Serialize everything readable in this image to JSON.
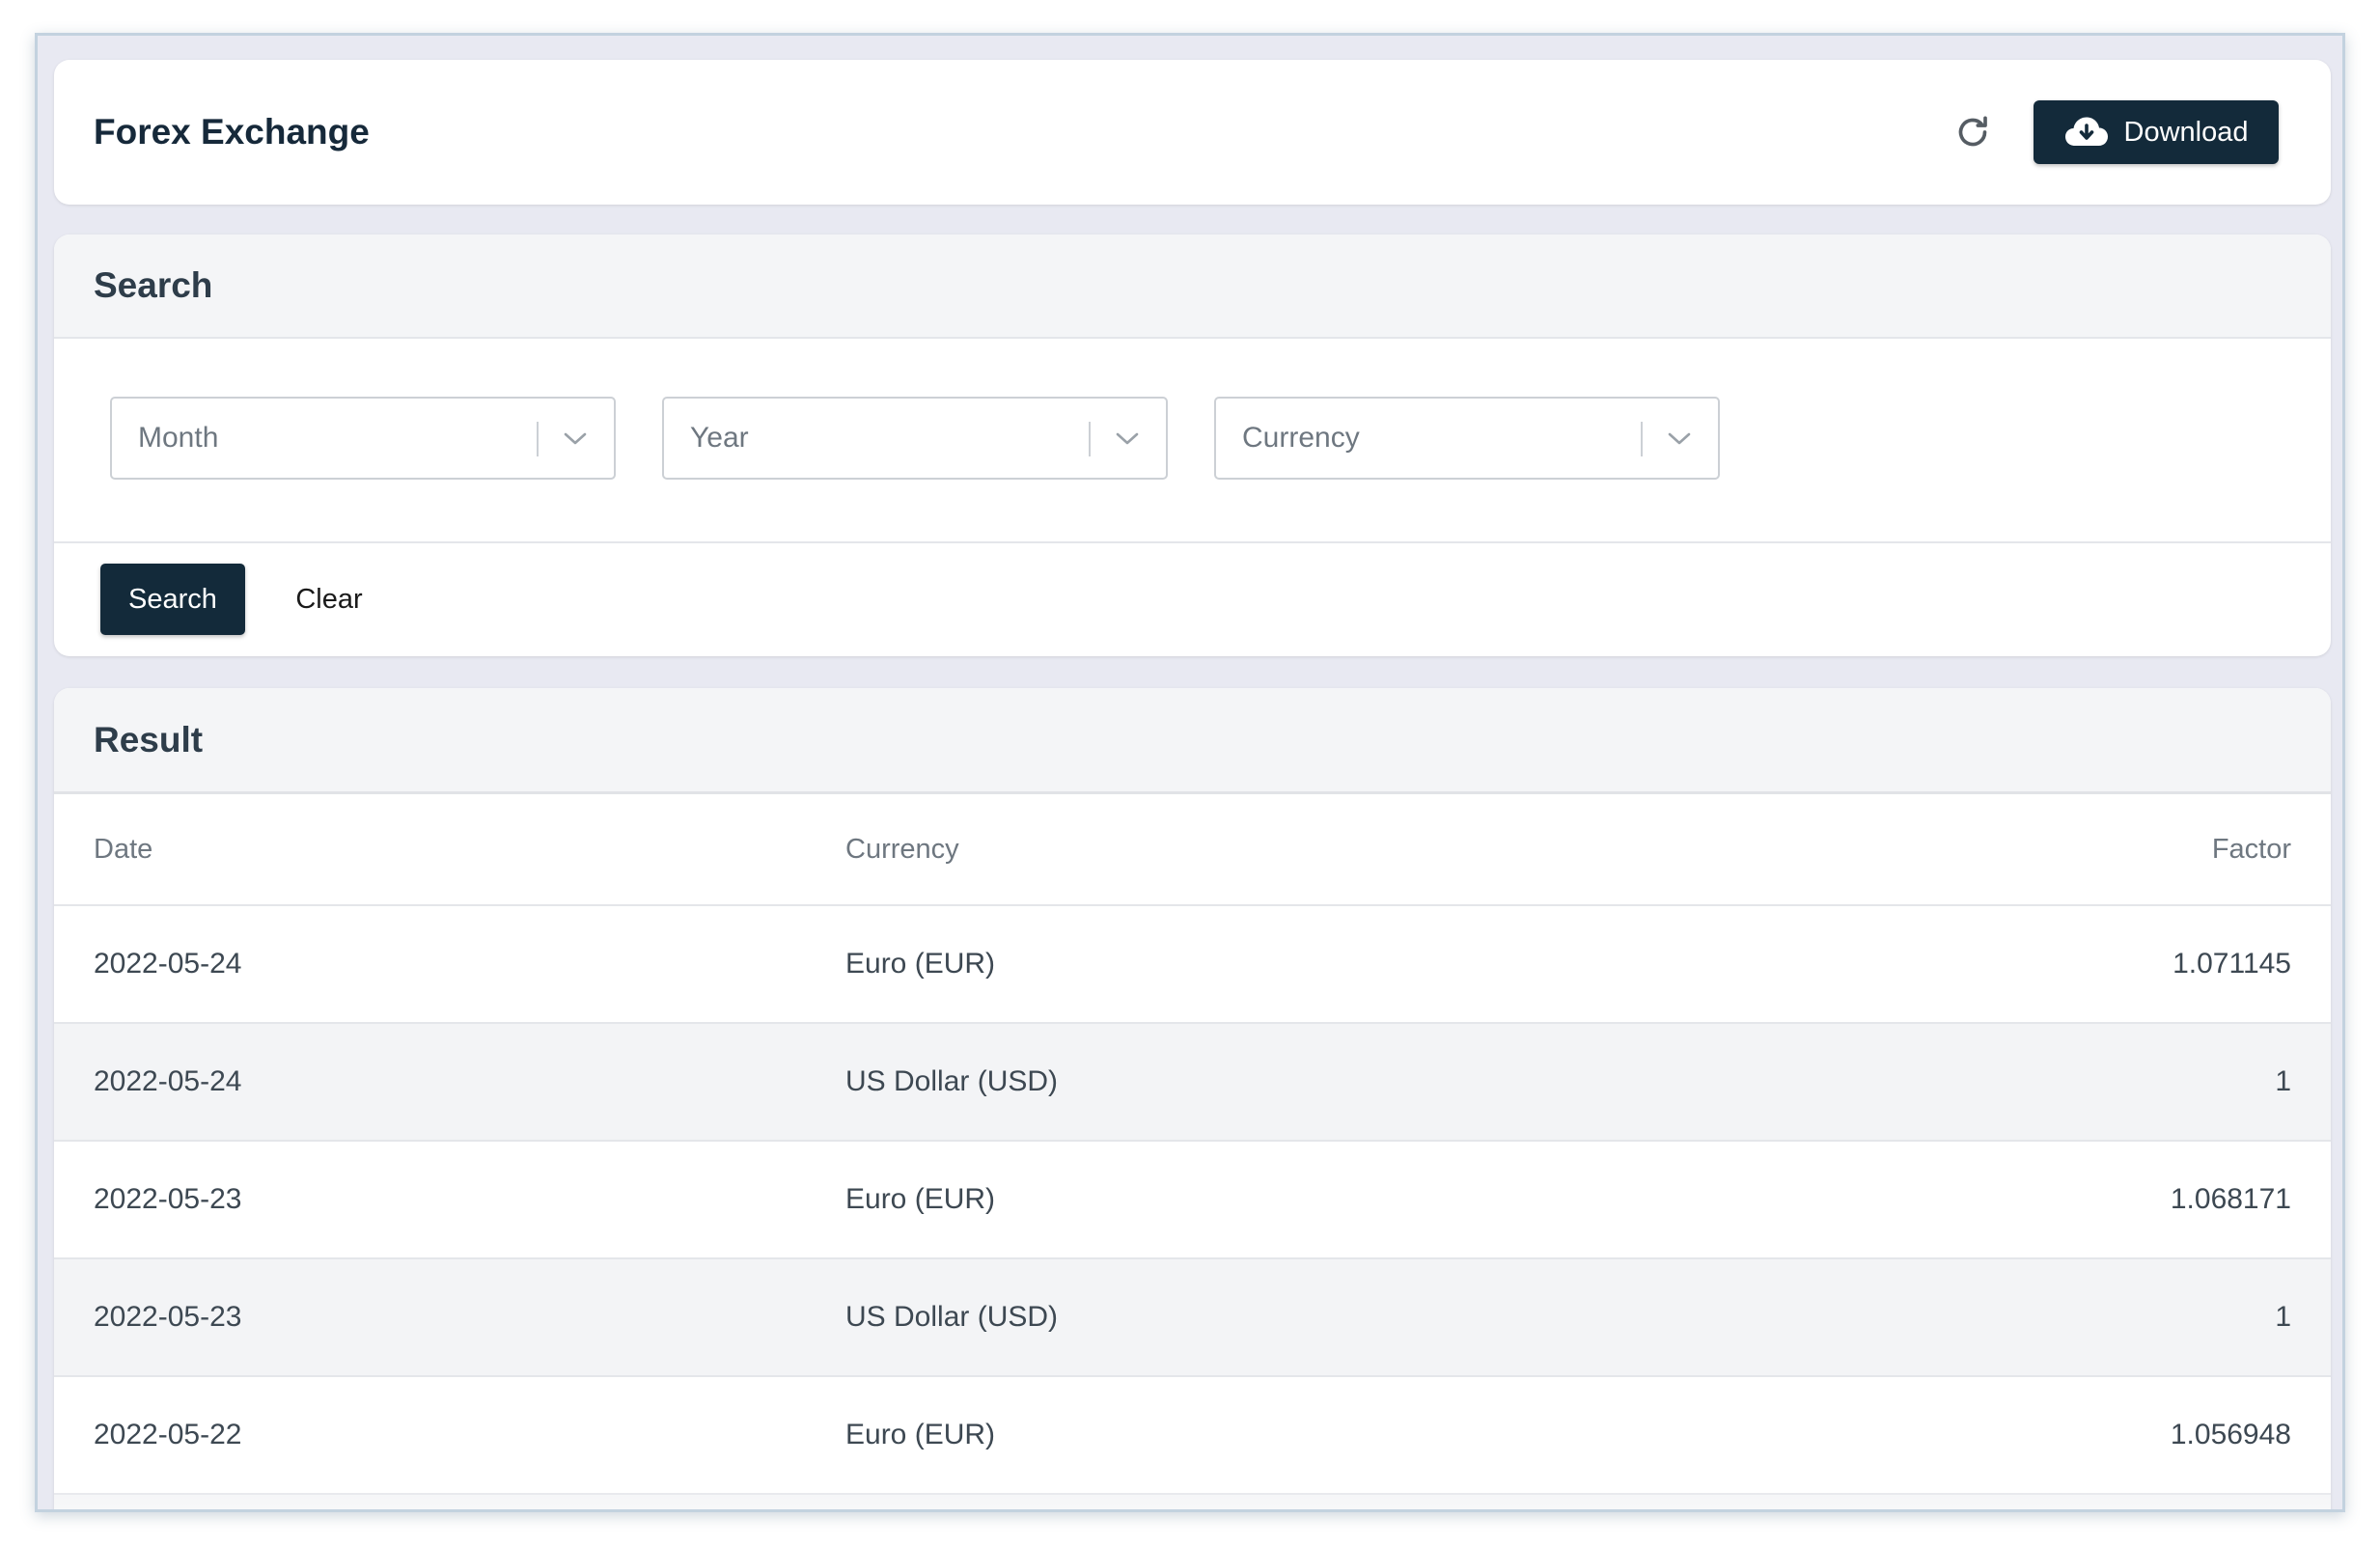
{
  "header": {
    "title": "Forex Exchange",
    "refresh_icon": "refresh-icon",
    "download_icon": "cloud-download-icon",
    "download_label": "Download"
  },
  "search": {
    "title": "Search",
    "filters": [
      {
        "placeholder": "Month",
        "icon": "chevron-down-icon"
      },
      {
        "placeholder": "Year",
        "icon": "chevron-down-icon"
      },
      {
        "placeholder": "Currency",
        "icon": "chevron-down-icon"
      }
    ],
    "search_label": "Search",
    "clear_label": "Clear"
  },
  "result": {
    "title": "Result",
    "columns": [
      "Date",
      "Currency",
      "Factor"
    ],
    "rows": [
      [
        "2022-05-24",
        "Euro (EUR)",
        "1.071145"
      ],
      [
        "2022-05-24",
        "US Dollar (USD)",
        "1"
      ],
      [
        "2022-05-23",
        "Euro (EUR)",
        "1.068171"
      ],
      [
        "2022-05-23",
        "US Dollar (USD)",
        "1"
      ],
      [
        "2022-05-22",
        "Euro (EUR)",
        "1.056948"
      ]
    ]
  },
  "colors": {
    "primary_button": "#132a3a",
    "page_background": "#e8e9f2",
    "card_header": "#f4f5f7",
    "alt_row": "#f3f4f6"
  }
}
